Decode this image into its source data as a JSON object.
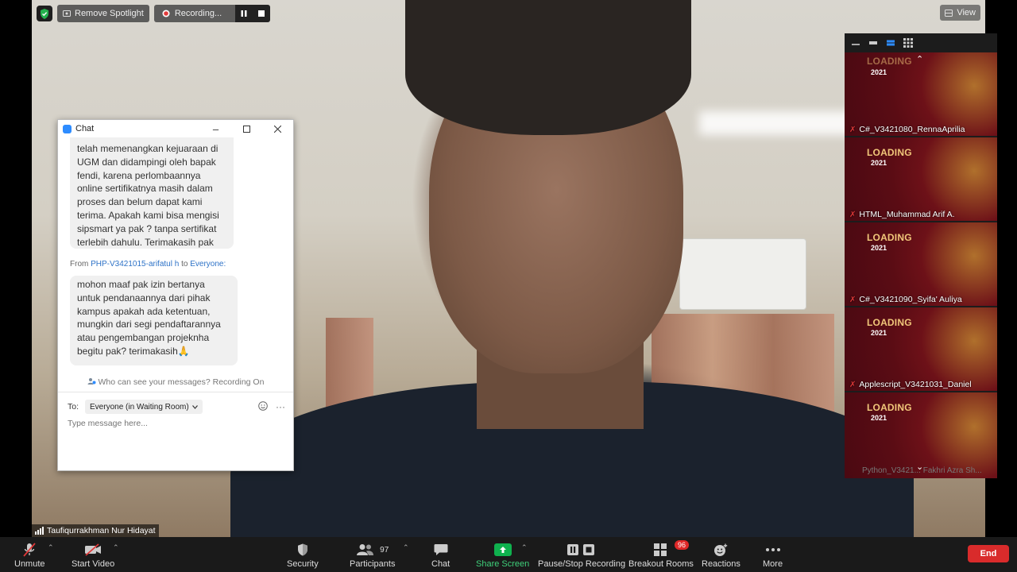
{
  "top_bar": {
    "remove_spotlight": "Remove Spotlight",
    "recording": "Recording...",
    "view": "View"
  },
  "chat": {
    "title": "Chat",
    "messages": [
      {
        "lines": [
          "telah memenangkan kejuaraan di",
          "UGM dan didampingi oleh bapak",
          "fendi, karena perlombaannya",
          "online sertifikatnya masih dalam",
          "proses dan belum dapat kami",
          "terima. Apakah kami bisa mengisi",
          "sipsmart ya pak ? tanpa sertifikat",
          "terlebih dahulu. Terimakasih pak"
        ]
      },
      {
        "from_prefix": "From",
        "from_sender": "PHP-V3421015-arifatul h",
        "from_to": "to",
        "from_recipient": "Everyone",
        "lines": [
          "mohon maaf pak izin bertanya",
          "untuk pendanaannya dari pihak",
          "kampus apakah ada ketentuan,",
          "mungkin dari segi pendaftarannya",
          "atau pengembangan projeknha",
          "begitu pak? terimakasih🙏"
        ]
      }
    ],
    "who_can_see": "Who can see your messages? Recording On",
    "to_label": "To:",
    "to_value": "Everyone (in Waiting Room)",
    "input_placeholder": "Type message here..."
  },
  "gallery": {
    "loading_text": "LOADING",
    "loading_year": "2021",
    "tiles": [
      {
        "name": "C#_V3421080_RennaAprilia"
      },
      {
        "name": "HTML_Muhammad Arif A."
      },
      {
        "name": "C#_V3421090_Syifa' Auliya"
      },
      {
        "name": "Applescript_V3421031_Daniel"
      },
      {
        "name": ""
      }
    ],
    "partial_next": "Python_V3421... Fakhri Azra Sh..."
  },
  "speaker": {
    "name": "Taufiqurrakhman Nur Hidayat"
  },
  "toolbar": {
    "unmute": "Unmute",
    "start_video": "Start Video",
    "security": "Security",
    "participants": "Participants",
    "participants_count": "97",
    "chat": "Chat",
    "share_screen": "Share Screen",
    "pause_stop_recording": "Pause/Stop Recording",
    "breakout_rooms": "Breakout Rooms",
    "breakout_badge": "96",
    "reactions": "Reactions",
    "more": "More",
    "end": "End"
  },
  "colors": {
    "share_green": "#0fb14e",
    "end_red": "#d92b2b",
    "link_blue": "#2d72c7",
    "tile_maroon": "#5a0c14",
    "loading_gold": "#f1c77a"
  }
}
